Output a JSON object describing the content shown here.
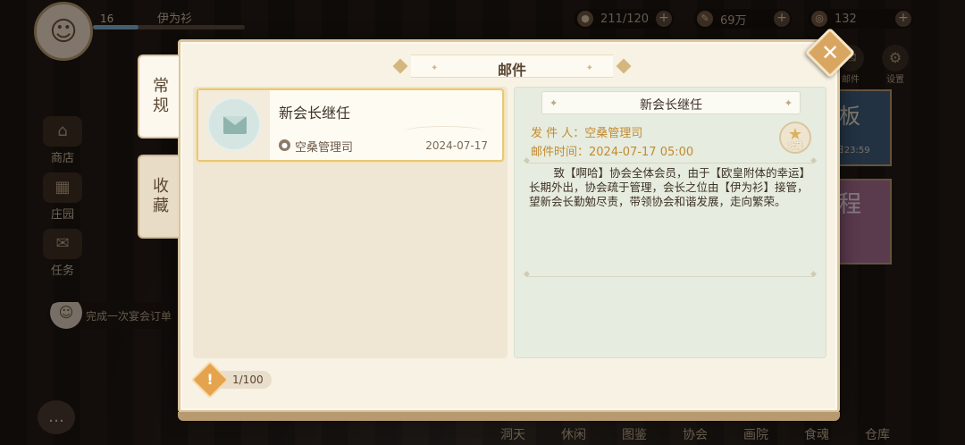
{
  "player": {
    "level": "16",
    "name": "伊为衫"
  },
  "resources": [
    {
      "icon": "stamina-icon",
      "glyph": "●",
      "value": "211/120"
    },
    {
      "icon": "feather-icon",
      "glyph": "✎",
      "value": "69万"
    },
    {
      "icon": "coin-icon",
      "glyph": "◎",
      "value": "132"
    }
  ],
  "left_menu": [
    {
      "name": "shop",
      "glyph": "⌂",
      "label": "商店"
    },
    {
      "name": "manor",
      "glyph": "▦",
      "label": "庄园"
    },
    {
      "name": "quest",
      "glyph": "✉",
      "label": "任务"
    }
  ],
  "task_tip": "完成一次宴会订单",
  "top_right_icons": [
    {
      "name": "mail",
      "glyph": "✉",
      "label": "邮件"
    },
    {
      "name": "settings",
      "glyph": "⚙",
      "label": "设置"
    }
  ],
  "banner": {
    "title": "板",
    "sub": "2日23:59",
    "title2": "程"
  },
  "bottom_nav": [
    {
      "name": "cave",
      "label": "洞天"
    },
    {
      "name": "leisure",
      "label": "休闲"
    },
    {
      "name": "atlas",
      "label": "图鉴"
    },
    {
      "name": "guild",
      "label": "协会"
    },
    {
      "name": "gallery",
      "label": "画院"
    },
    {
      "name": "soul",
      "label": "食魂"
    },
    {
      "name": "warehouse",
      "label": "仓库"
    }
  ],
  "dialog": {
    "title": "邮件",
    "close_glyph": "✕",
    "tabs": {
      "normal": "常规",
      "favorite": "收藏"
    },
    "mail_list": [
      {
        "subject": "新会长继任",
        "sender": "空桑管理司",
        "date": "2024-07-17"
      }
    ],
    "detail": {
      "title": "新会长继任",
      "from_label": "发 件 人：",
      "from": "空桑管理司",
      "time_label": "邮件时间：",
      "time": "2024-07-17 05:00",
      "favorite_label": "收藏",
      "body": "致【啊哈】协会全体会员，由于【欧皇附体的幸运】长期外出，协会疏于管理，会长之位由【伊为衫】接管，望新会长勤勉尽责，带领协会和谐发展，走向繁荣。"
    },
    "counter": "1/100",
    "counter_glyph": "!"
  },
  "colors": {
    "dialog_bg": "#f8f2e4",
    "accent_gold": "#d9a662",
    "meta_text": "#c38a30",
    "selected_border": "#e7c87a"
  }
}
